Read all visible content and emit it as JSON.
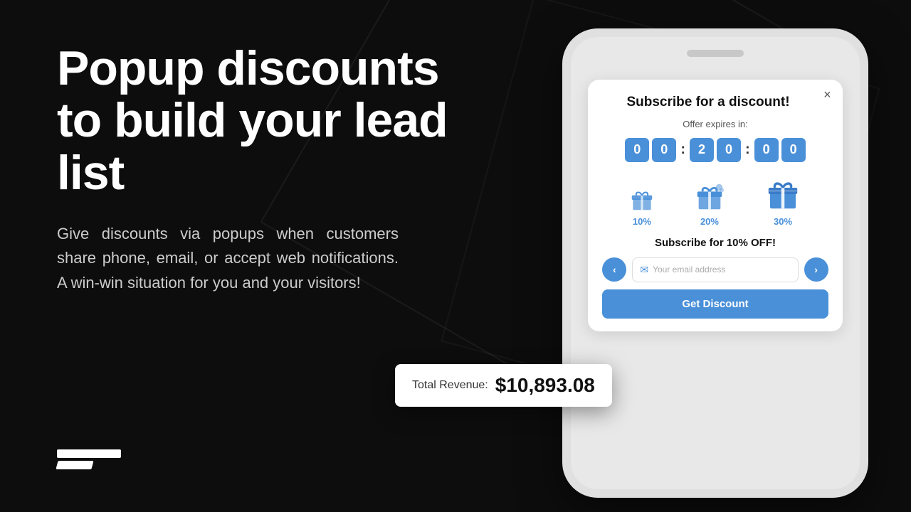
{
  "background": {
    "color": "#0d0d0d"
  },
  "left": {
    "headline": "Popup discounts to build your lead list",
    "description": "Give discounts via popups when customers share phone, email, or accept web notifications. A win-win situation for you and your visitors!"
  },
  "revenue_badge": {
    "label": "Total Revenue:",
    "amount": "$10,893.08"
  },
  "logo": {
    "alt": "Brand logo"
  },
  "popup": {
    "title": "Subscribe for a discount!",
    "close_label": "×",
    "offer_expires": "Offer expires in:",
    "timer": {
      "digits": [
        "0",
        "0",
        "2",
        "0",
        "0",
        "0"
      ]
    },
    "gifts": [
      {
        "size": "small",
        "percent": "10%"
      },
      {
        "size": "medium",
        "percent": "20%"
      },
      {
        "size": "large",
        "percent": "30%"
      }
    ],
    "subscribe_text": "Subscribe for 10% OFF!",
    "email_placeholder": "Your email address",
    "get_discount_label": "Get Discount",
    "nav_left": "‹",
    "nav_right": "›"
  }
}
